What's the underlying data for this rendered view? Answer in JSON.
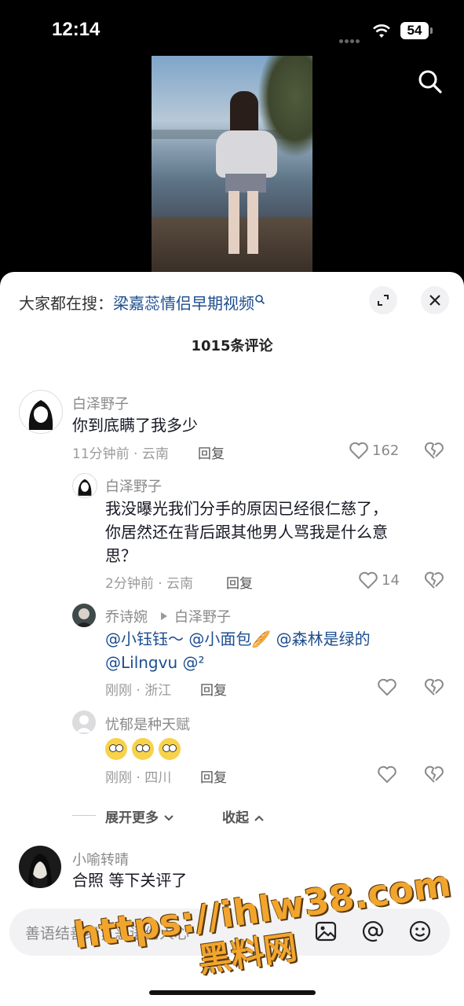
{
  "status": {
    "time": "12:14",
    "battery": "54"
  },
  "sheet": {
    "search_prefix": "大家都在搜：",
    "search_keyword": "梁嘉蕊情侣早期视频",
    "comment_count": "1015条评论"
  },
  "comments": [
    {
      "user": "白泽野子",
      "text": "你到底瞒了我多少",
      "time": "11分钟前 · 云南",
      "reply": "回复",
      "likes": "162"
    },
    {
      "user": "白泽野子",
      "text_lines": [
        "我没曝光我们分手的原因已经很仁慈了，",
        "你居然还在背后跟其他男人骂我是什么意",
        "思？"
      ],
      "time": "2分钟前 · 云南",
      "reply": "回复",
      "likes": "14"
    },
    {
      "user": "乔诗婉",
      "reply_to": "白泽野子",
      "mentions_line1": "@小钰钰～ @小面包🥖 @森林是绿的",
      "mentions_line2": "@Lilngvu @²",
      "time": "刚刚 · 浙江",
      "reply": "回复"
    },
    {
      "user": "忧郁是种天赋",
      "time": "刚刚 · 四川",
      "reply": "回复"
    },
    {
      "user": "小喻转晴",
      "text": "合照 等下关评了"
    }
  ],
  "more": {
    "expand": "展开更多",
    "collapse": "收起"
  },
  "input": {
    "placeholder": "善语结善缘，恶语伤人心"
  },
  "watermark": {
    "url": "https://ihlw38.com",
    "name": "黑料网"
  }
}
